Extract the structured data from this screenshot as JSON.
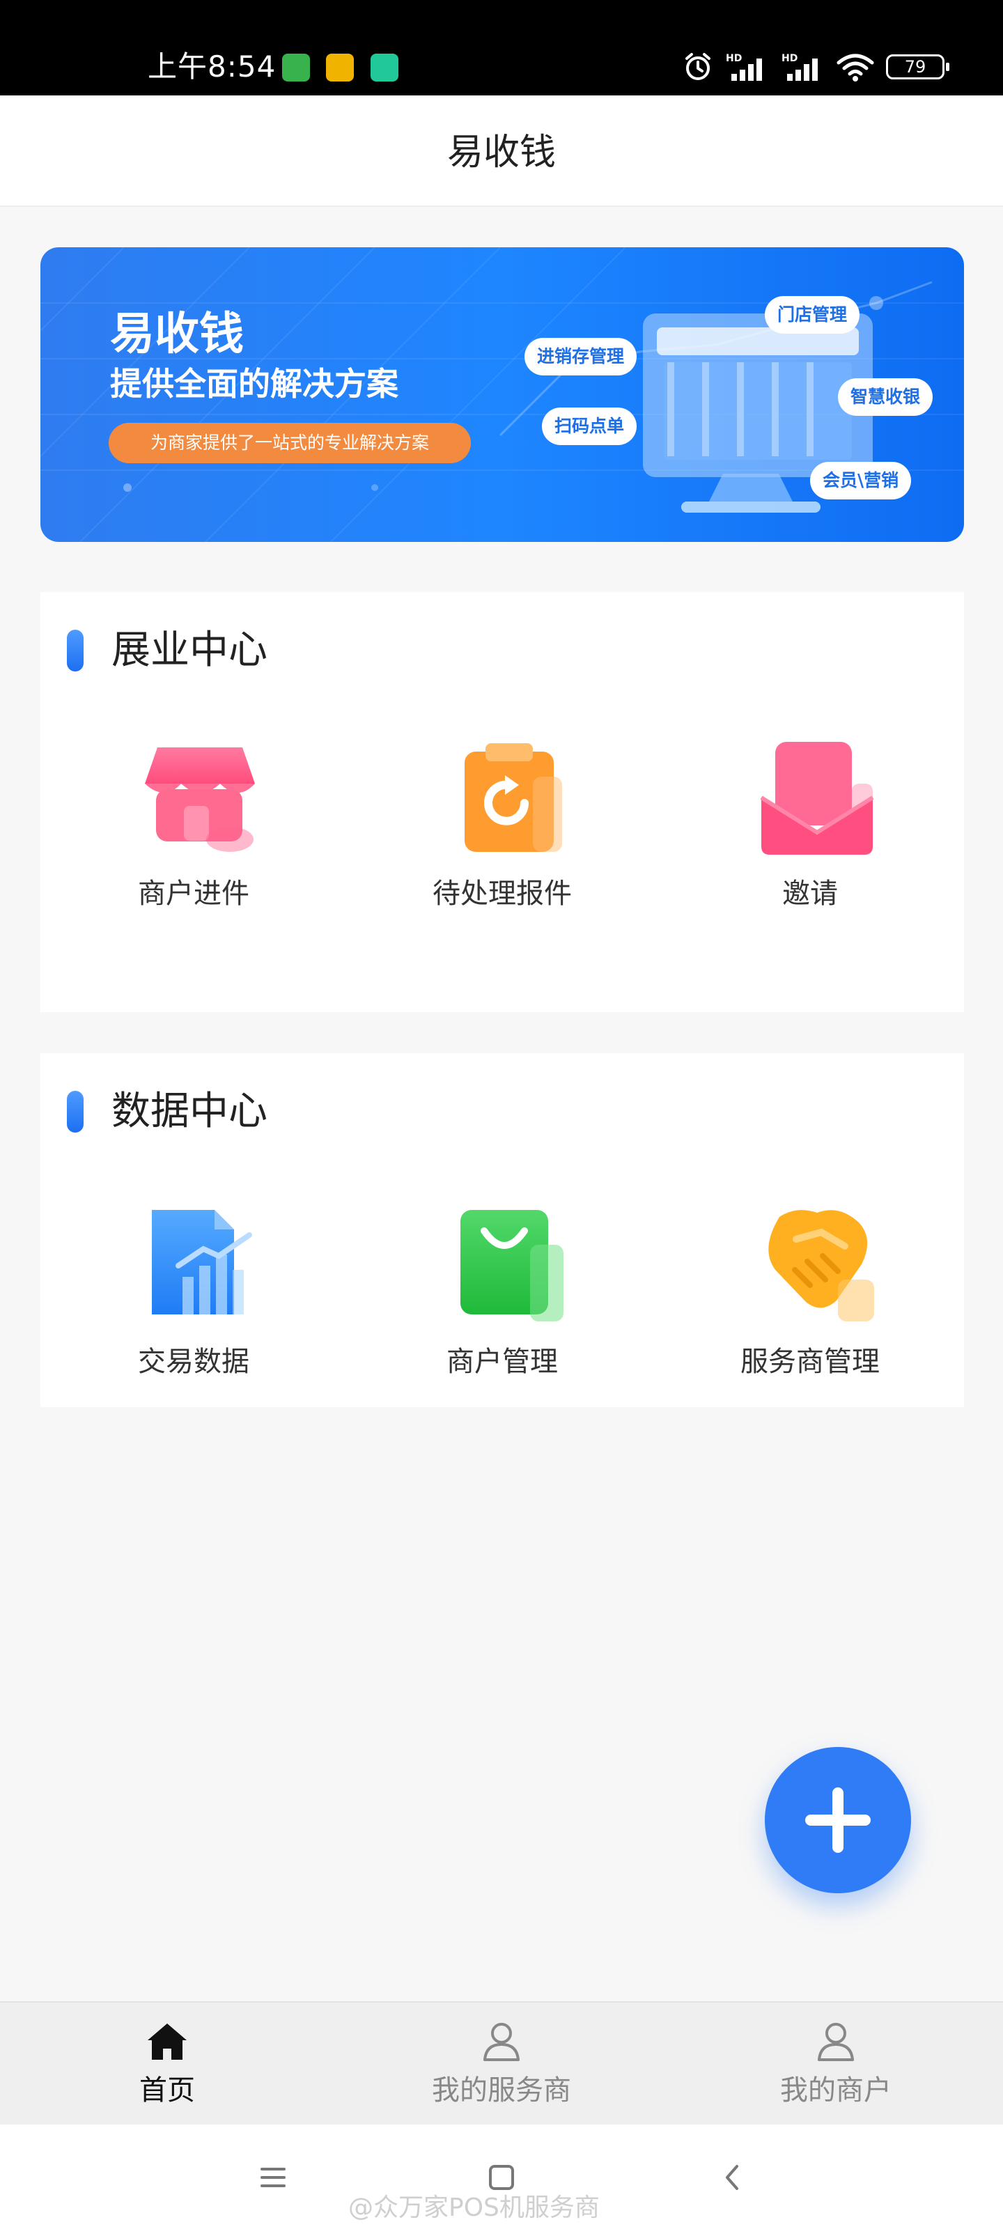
{
  "status_bar": {
    "time": "上午8:54",
    "battery": "79",
    "icons": [
      "alarm-icon",
      "signal-hd-icon",
      "signal-hd-icon",
      "wifi-icon",
      "battery-icon"
    ]
  },
  "header": {
    "title": "易收钱"
  },
  "banner": {
    "title": "易收钱",
    "subtitle": "提供全面的解决方案",
    "pill": "为商家提供了一站式的专业解决方案",
    "tags": [
      "门店管理",
      "进销存管理",
      "智慧收银",
      "扫码点单",
      "会员\\营销"
    ]
  },
  "sections": [
    {
      "title": "展业中心",
      "items": [
        {
          "label": "商户进件",
          "icon": "store-icon"
        },
        {
          "label": "待处理报件",
          "icon": "clipboard-refresh-icon"
        },
        {
          "label": "邀请",
          "icon": "envelope-icon"
        }
      ]
    },
    {
      "title": "数据中心",
      "items": [
        {
          "label": "交易数据",
          "icon": "chart-document-icon"
        },
        {
          "label": "商户管理",
          "icon": "shopping-bag-icon"
        },
        {
          "label": "服务商管理",
          "icon": "handshake-icon"
        }
      ]
    }
  ],
  "tabbar": {
    "items": [
      {
        "label": "首页",
        "icon": "home-icon",
        "active": true
      },
      {
        "label": "我的服务商",
        "icon": "person-icon",
        "active": false
      },
      {
        "label": "我的商户",
        "icon": "person-icon",
        "active": false
      }
    ]
  },
  "watermark": "@众万家POS机服务商",
  "colors": {
    "accent": "#2f7cf6",
    "banner": "#1e86ff"
  }
}
